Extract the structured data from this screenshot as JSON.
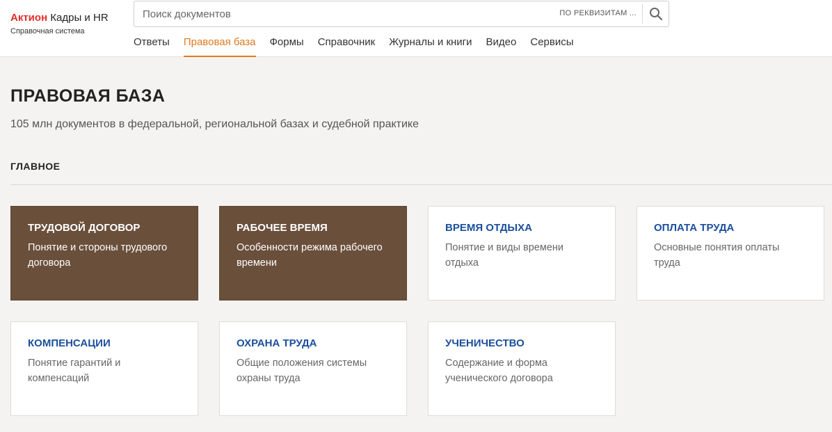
{
  "logo": {
    "brand": "Актион",
    "product": "Кадры и HR",
    "subtitle": "Справочная система"
  },
  "search": {
    "placeholder": "Поиск документов",
    "requisites_label": "ПО РЕКВИЗИТАМ ...",
    "icon": "search-icon"
  },
  "nav": {
    "items": [
      {
        "label": "Ответы"
      },
      {
        "label": "Правовая база",
        "active": true
      },
      {
        "label": "Формы"
      },
      {
        "label": "Справочник"
      },
      {
        "label": "Журналы и книги"
      },
      {
        "label": "Видео"
      },
      {
        "label": "Сервисы"
      }
    ]
  },
  "page": {
    "title": "ПРАВОВАЯ БАЗА",
    "subtitle": "105 млн документов в федеральной, региональной базах и судебной практике",
    "section_title": "ГЛАВНОЕ"
  },
  "colors": {
    "brand_red": "#e52d27",
    "accent_orange": "#e07a1f",
    "link_blue": "#1b4f9c",
    "card_dark": "#6a4f3b"
  },
  "cards": [
    {
      "title": "ТРУДОВОЙ ДОГОВОР",
      "desc": "Понятие и стороны трудового договора",
      "style": "dark"
    },
    {
      "title": "РАБОЧЕЕ ВРЕМЯ",
      "desc": "Особенности режима рабочего времени",
      "style": "dark"
    },
    {
      "title": "ВРЕМЯ ОТДЫХА",
      "desc": "Понятие и виды времени отдыха",
      "style": "light"
    },
    {
      "title": "ОПЛАТА ТРУДА",
      "desc": "Основные понятия оплаты труда",
      "style": "light"
    },
    {
      "title": "КОМПЕНСАЦИИ",
      "desc": "Понятие гарантий и компенсаций",
      "style": "light"
    },
    {
      "title": "ОХРАНА ТРУДА",
      "desc": "Общие положения системы охраны труда",
      "style": "light"
    },
    {
      "title": "УЧЕНИЧЕСТВО",
      "desc": "Содержание и форма ученического договора",
      "style": "light"
    }
  ]
}
